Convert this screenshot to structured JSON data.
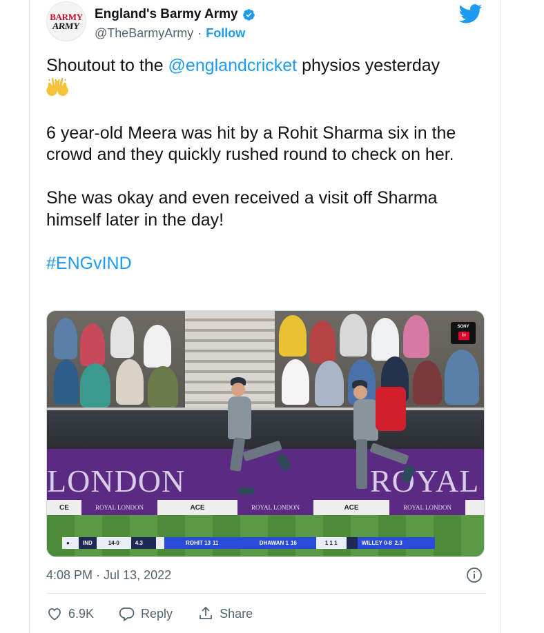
{
  "account": {
    "display_name": "England's Barmy Army",
    "handle": "@TheBarmyArmy",
    "separator": "·",
    "follow_label": "Follow",
    "avatar_line1": "BARMY",
    "avatar_line2": "ARMY",
    "verified": true
  },
  "tweet": {
    "p1_prefix": "Shoutout to the ",
    "p1_mention": "@englandcricket",
    "p1_suffix": " physios yesterday",
    "p1_emoji": "raising-hands",
    "p2": "6 year-old Meera was hit by a Rohit Sharma six in the crowd and they quickly rushed round to check on her.",
    "p3": "She was okay and even received a visit off Sharma himself later in the day!",
    "hashtag": "#ENGvIND"
  },
  "media": {
    "banner_left": "LONDON",
    "banner_right": "ROYAL",
    "ads": [
      "CE",
      "ROYAL LONDON",
      "ACE",
      "ROYAL LONDON",
      "ACE",
      "ROYAL LONDON"
    ],
    "tv_logo_top": "SONY",
    "tv_logo_bottom": "liv",
    "scoreboard": {
      "team": "IND",
      "score": "14-0",
      "overs": "4.3",
      "batter1": "ROHIT 13",
      "batter1_balls": "11",
      "batter2": "DHAWAN 1",
      "batter2_balls": "16",
      "this_over": "1 1 1",
      "bowler": "WILLEY 0-8",
      "bowler_overs": "2.3"
    }
  },
  "meta": {
    "timestamp": "4:08 PM · Jul 13, 2022"
  },
  "actions": {
    "like_count": "6.9K",
    "reply_label": "Reply",
    "share_label": "Share"
  },
  "colors": {
    "twitter_blue": "#1d9bf0",
    "text_secondary": "#536471",
    "banner_purple": "#5b2a82"
  }
}
